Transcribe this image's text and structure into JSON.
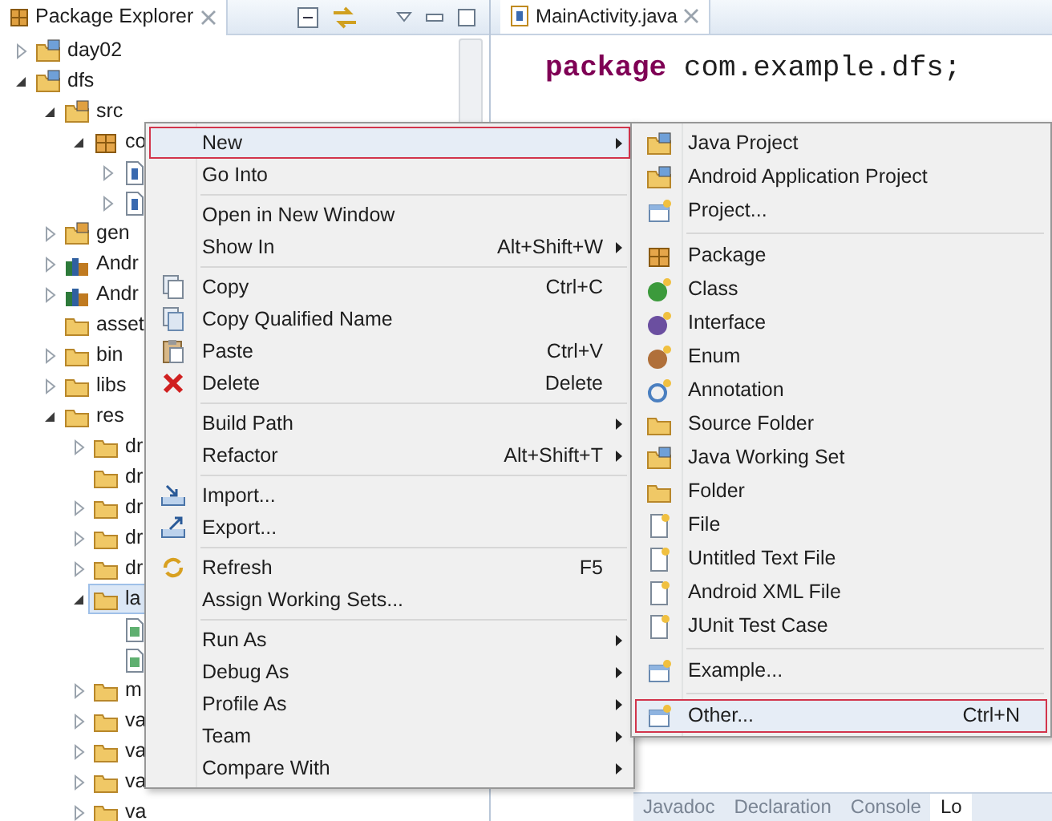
{
  "explorer": {
    "title": "Package Explorer",
    "tree": [
      {
        "label": "day02",
        "kind": "project",
        "expanded": false,
        "selected": false
      },
      {
        "label": "dfs",
        "kind": "project",
        "expanded": true,
        "selected": false,
        "children": [
          {
            "label": "src",
            "kind": "sourcefolder",
            "expanded": true,
            "selected": false,
            "children": [
              {
                "label": "co",
                "kind": "package",
                "expanded": true,
                "selected": false,
                "children": [
                  {
                    "kind": "javafile",
                    "expanded": false,
                    "selected": false
                  },
                  {
                    "kind": "javafile",
                    "expanded": false,
                    "selected": false
                  }
                ]
              }
            ]
          },
          {
            "label": "gen",
            "kind": "sourcefolder",
            "expanded": false,
            "selected": false
          },
          {
            "label": "Andr",
            "kind": "library",
            "expanded": false,
            "selected": false
          },
          {
            "label": "Andr",
            "kind": "library",
            "expanded": false,
            "selected": false
          },
          {
            "label": "asset",
            "kind": "folder",
            "selected": false
          },
          {
            "label": "bin",
            "kind": "folder",
            "expanded": false,
            "selected": false
          },
          {
            "label": "libs",
            "kind": "folder",
            "expanded": false,
            "selected": false
          },
          {
            "label": "res",
            "kind": "folder",
            "expanded": true,
            "selected": false,
            "children": [
              {
                "label": "dr",
                "kind": "folder",
                "expanded": false,
                "selected": false
              },
              {
                "label": "dr",
                "kind": "folder",
                "selected": false
              },
              {
                "label": "dr",
                "kind": "folder",
                "expanded": false,
                "selected": false
              },
              {
                "label": "dr",
                "kind": "folder",
                "expanded": false,
                "selected": false
              },
              {
                "label": "dr",
                "kind": "folder",
                "expanded": false,
                "selected": false
              },
              {
                "label": "la",
                "kind": "folder",
                "expanded": true,
                "selected": true,
                "children": [
                  {
                    "kind": "xmlfile",
                    "selected": false
                  },
                  {
                    "kind": "xmlfile",
                    "selected": false
                  }
                ]
              },
              {
                "label": "m",
                "kind": "folder",
                "expanded": false,
                "selected": false
              },
              {
                "label": "va",
                "kind": "folder",
                "expanded": false,
                "selected": false
              },
              {
                "label": "va",
                "kind": "folder",
                "expanded": false,
                "selected": false
              },
              {
                "label": "va",
                "kind": "folder",
                "expanded": false,
                "selected": false
              },
              {
                "label": "va",
                "kind": "folder",
                "expanded": false,
                "selected": false
              }
            ]
          }
        ]
      }
    ]
  },
  "editor": {
    "tab": {
      "label": "MainActivity.java"
    },
    "code": [
      {
        "keyword": "package",
        "text": " com.example.dfs;"
      }
    ]
  },
  "context_menu": {
    "items": [
      {
        "kind": "plain",
        "label": "New",
        "submenu": true,
        "selected": true
      },
      {
        "kind": "plain",
        "label": "Go Into",
        "submenu": false,
        "selected": false
      },
      {
        "kind": "separator"
      },
      {
        "kind": "plain",
        "label": "Open in New Window",
        "submenu": false,
        "selected": false
      },
      {
        "kind": "plain",
        "label": "Show In",
        "shortcut": "Alt+Shift+W",
        "submenu": true,
        "selected": false
      },
      {
        "kind": "separator"
      },
      {
        "kind": "copy",
        "label": "Copy",
        "shortcut": "Ctrl+C",
        "submenu": false,
        "selected": false
      },
      {
        "kind": "copyname",
        "label": "Copy Qualified Name",
        "submenu": false,
        "selected": false
      },
      {
        "kind": "paste",
        "label": "Paste",
        "shortcut": "Ctrl+V",
        "submenu": false,
        "selected": false
      },
      {
        "kind": "delete",
        "label": "Delete",
        "shortcut": "Delete",
        "submenu": false,
        "selected": false
      },
      {
        "kind": "separator"
      },
      {
        "kind": "plain",
        "label": "Build Path",
        "submenu": true,
        "selected": false
      },
      {
        "kind": "plain",
        "label": "Refactor",
        "shortcut": "Alt+Shift+T",
        "submenu": true,
        "selected": false
      },
      {
        "kind": "separator"
      },
      {
        "kind": "import",
        "label": "Import...",
        "submenu": false,
        "selected": false
      },
      {
        "kind": "export",
        "label": "Export...",
        "submenu": false,
        "selected": false
      },
      {
        "kind": "separator"
      },
      {
        "kind": "refresh",
        "label": "Refresh",
        "shortcut": "F5",
        "submenu": false,
        "selected": false
      },
      {
        "kind": "plain",
        "label": "Assign Working Sets...",
        "submenu": false,
        "selected": false
      },
      {
        "kind": "separator"
      },
      {
        "kind": "plain",
        "label": "Run As",
        "submenu": true,
        "selected": false
      },
      {
        "kind": "plain",
        "label": "Debug As",
        "submenu": true,
        "selected": false
      },
      {
        "kind": "plain",
        "label": "Profile As",
        "submenu": true,
        "selected": false
      },
      {
        "kind": "plain",
        "label": "Team",
        "submenu": true,
        "selected": false
      },
      {
        "kind": "plain",
        "label": "Compare With",
        "submenu": true,
        "selected": false
      }
    ]
  },
  "submenu": {
    "items": [
      {
        "kind": "project",
        "label": "Java Project",
        "selected": false
      },
      {
        "kind": "project",
        "label": "Android Application Project",
        "selected": false
      },
      {
        "kind": "wizard",
        "label": "Project...",
        "selected": false
      },
      {
        "kind": "separator"
      },
      {
        "kind": "package",
        "label": "Package",
        "selected": false
      },
      {
        "kind": "class",
        "label": "Class",
        "selected": false
      },
      {
        "kind": "interface",
        "label": "Interface",
        "selected": false
      },
      {
        "kind": "enum",
        "label": "Enum",
        "selected": false
      },
      {
        "kind": "annotation",
        "label": "Annotation",
        "selected": false
      },
      {
        "kind": "folder",
        "label": "Source Folder",
        "selected": false
      },
      {
        "kind": "project",
        "label": "Java Working Set",
        "selected": false
      },
      {
        "kind": "folder",
        "label": "Folder",
        "selected": false
      },
      {
        "kind": "file",
        "label": "File",
        "selected": false
      },
      {
        "kind": "file",
        "label": "Untitled Text File",
        "selected": false
      },
      {
        "kind": "file",
        "label": "Android XML File",
        "selected": false
      },
      {
        "kind": "file",
        "label": "JUnit Test Case",
        "selected": false
      },
      {
        "kind": "separator"
      },
      {
        "kind": "wizard",
        "label": "Example...",
        "selected": false
      },
      {
        "kind": "separator"
      },
      {
        "kind": "wizard",
        "label": "Other...",
        "shortcut": "Ctrl+N",
        "selected": true
      }
    ]
  },
  "bottom_tabs": [
    {
      "label": "Javadoc",
      "selected": false
    },
    {
      "label": "Declaration",
      "selected": false
    },
    {
      "label": "Console",
      "selected": false
    },
    {
      "label": "Lo",
      "selected": true
    }
  ]
}
